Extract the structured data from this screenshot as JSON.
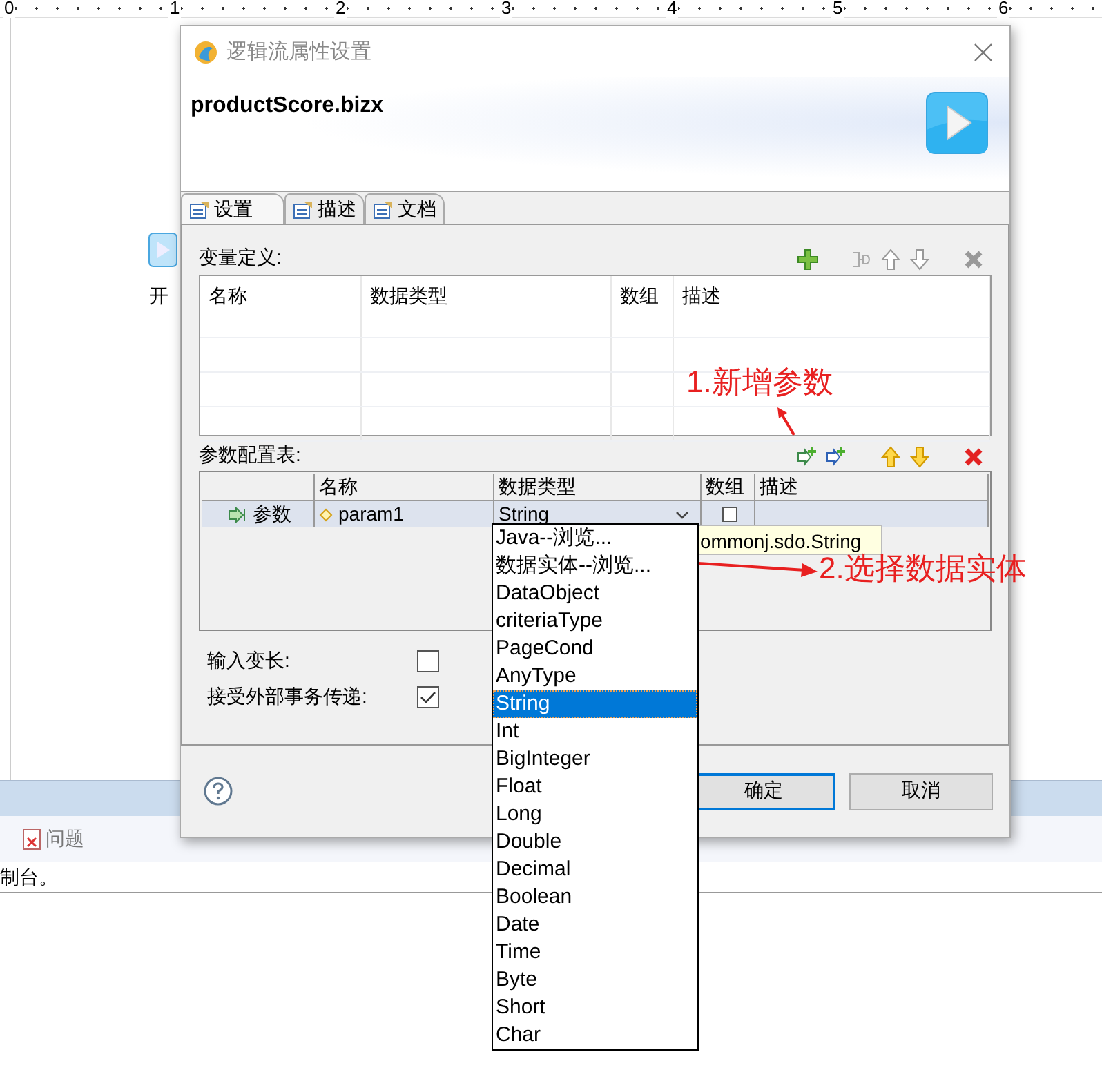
{
  "background": {
    "ruler_labels": [
      "0",
      "1",
      "2",
      "3",
      "4",
      "5",
      "6"
    ],
    "canvas_node_label": "开",
    "panel_tabs": [
      {
        "label": "问题"
      }
    ],
    "console_text": "制台。"
  },
  "dialog": {
    "title": "逻辑流属性设置",
    "header_title": "productScore.bizx",
    "tabs": [
      {
        "label": "设置",
        "selected": true
      },
      {
        "label": "描述",
        "selected": false
      },
      {
        "label": "文档",
        "selected": false
      }
    ],
    "variables": {
      "label": "变量定义:",
      "columns": [
        "名称",
        "数据类型",
        "数组",
        "描述"
      ]
    },
    "parameters": {
      "label": "参数配置表:",
      "columns": [
        "名称",
        "数据类型",
        "数组",
        "描述"
      ],
      "rows": [
        {
          "row_label": "参数",
          "name": "param1",
          "type": "String",
          "array": false,
          "selected": true
        }
      ]
    },
    "tooltip": "ommonj.sdo.String",
    "options": [
      {
        "label": "输入变长:",
        "checked": false
      },
      {
        "label": "接受外部事务传递:",
        "checked": true
      }
    ],
    "buttons": [
      {
        "label": "确定",
        "default": true
      },
      {
        "label": "取消",
        "default": false
      }
    ]
  },
  "dropdown": {
    "items": [
      {
        "label": "Java--浏览...",
        "selected": false
      },
      {
        "label": "数据实体--浏览...",
        "selected": false
      },
      {
        "label": "DataObject",
        "selected": false
      },
      {
        "label": "criteriaType",
        "selected": false
      },
      {
        "label": "PageCond",
        "selected": false
      },
      {
        "label": "AnyType",
        "selected": false
      },
      {
        "label": "String",
        "selected": true
      },
      {
        "label": "Int",
        "selected": false
      },
      {
        "label": "BigInteger",
        "selected": false
      },
      {
        "label": "Float",
        "selected": false
      },
      {
        "label": "Long",
        "selected": false
      },
      {
        "label": "Double",
        "selected": false
      },
      {
        "label": "Decimal",
        "selected": false
      },
      {
        "label": "Boolean",
        "selected": false
      },
      {
        "label": "Date",
        "selected": false
      },
      {
        "label": "Time",
        "selected": false
      },
      {
        "label": "Byte",
        "selected": false
      },
      {
        "label": "Short",
        "selected": false
      },
      {
        "label": "Char",
        "selected": false
      }
    ]
  },
  "annotations": [
    {
      "kind": "up",
      "text": "1.新增参数"
    },
    {
      "kind": "right",
      "text": "2.选择数据实体"
    }
  ]
}
